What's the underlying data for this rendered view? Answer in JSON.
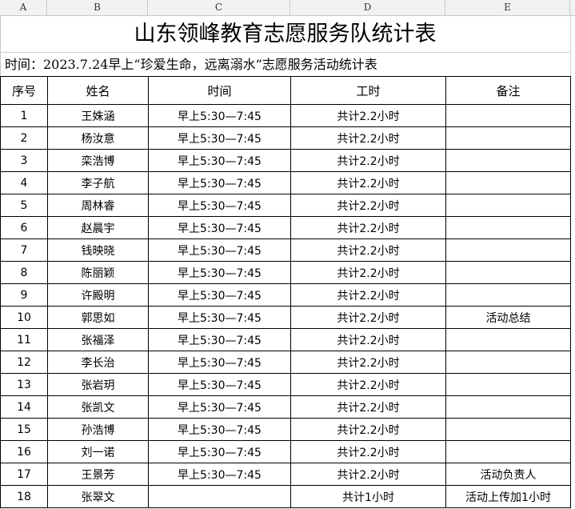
{
  "columns": [
    "A",
    "B",
    "C",
    "D",
    "E"
  ],
  "title": "山东领峰教育志愿服务队统计表",
  "subtitle": "时间：2023.7.24早上“珍爱生命，远离溺水”志愿服务活动统计表",
  "headers": [
    "序号",
    "姓名",
    "时间",
    "工时",
    "备注"
  ],
  "rows": [
    [
      "1",
      "王姝涵",
      "早上5:30—7:45",
      "共计2.2小时",
      ""
    ],
    [
      "2",
      "杨汝意",
      "早上5:30—7:45",
      "共计2.2小时",
      ""
    ],
    [
      "3",
      "栾浩博",
      "早上5:30—7:45",
      "共计2.2小时",
      ""
    ],
    [
      "4",
      "李子航",
      "早上5:30—7:45",
      "共计2.2小时",
      ""
    ],
    [
      "5",
      "周林睿",
      "早上5:30—7:45",
      "共计2.2小时",
      ""
    ],
    [
      "6",
      "赵晨宇",
      "早上5:30—7:45",
      "共计2.2小时",
      ""
    ],
    [
      "7",
      "钱映晓",
      "早上5:30—7:45",
      "共计2.2小时",
      ""
    ],
    [
      "8",
      "陈丽颖",
      "早上5:30—7:45",
      "共计2.2小时",
      ""
    ],
    [
      "9",
      "许殿明",
      "早上5:30—7:45",
      "共计2.2小时",
      ""
    ],
    [
      "10",
      "郭思如",
      "早上5:30—7:45",
      "共计2.2小时",
      "活动总结"
    ],
    [
      "11",
      "张福泽",
      "早上5:30—7:45",
      "共计2.2小时",
      ""
    ],
    [
      "12",
      "李长治",
      "早上5:30—7:45",
      "共计2.2小时",
      ""
    ],
    [
      "13",
      "张岩玥",
      "早上5:30—7:45",
      "共计2.2小时",
      ""
    ],
    [
      "14",
      "张凯文",
      "早上5:30—7:45",
      "共计2.2小时",
      ""
    ],
    [
      "15",
      "孙浩博",
      "早上5:30—7:45",
      "共计2.2小时",
      ""
    ],
    [
      "16",
      "刘一诺",
      "早上5:30—7:45",
      "共计2.2小时",
      ""
    ],
    [
      "17",
      "王景芳",
      "早上5:30—7:45",
      "共计2.2小时",
      "活动负责人"
    ],
    [
      "18",
      "张翠文",
      "",
      "共计1小时",
      "活动上传加1小时"
    ]
  ]
}
